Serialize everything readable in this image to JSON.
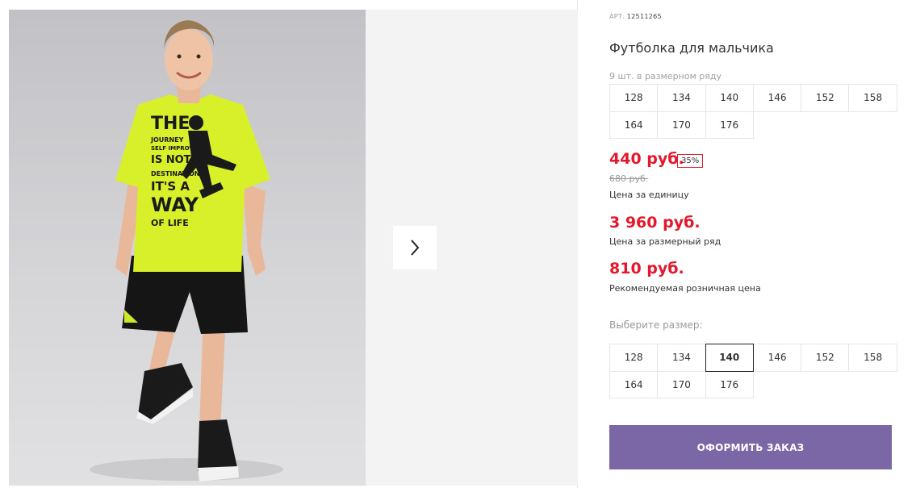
{
  "gallery": {
    "next_icon": "chevron-right-icon",
    "shirt_print": [
      "THE",
      "JOURNEY",
      "SELF IMPROVE",
      "IS NOT",
      "DESTINATION",
      "IT'S A",
      "WAY",
      "OF LIFE"
    ]
  },
  "product": {
    "art_label": "АРТ.",
    "art_value": "12511265",
    "title": "Футболка для мальчика",
    "in_row_text": "9 шт. в размерном ряду",
    "row_sizes": [
      "128",
      "134",
      "140",
      "146",
      "152",
      "158",
      "164",
      "170",
      "176"
    ],
    "price": "440 руб.",
    "discount": "35%",
    "old_price": "680 руб.",
    "price_unit_caption": "Цена за единицу",
    "price_row": "3 960 руб.",
    "price_row_caption": "Цена за размерный ряд",
    "price_rrc": "810 руб.",
    "price_rrc_caption": "Рекомендуемая розничная цена",
    "choose_size_label": "Выберите размер:",
    "sizes": [
      "128",
      "134",
      "140",
      "146",
      "152",
      "158",
      "164",
      "170",
      "176"
    ],
    "selected_size": "140",
    "order_button": "ОФОРМИТЬ ЗАКАЗ"
  },
  "colors": {
    "price_red": "#e3182d",
    "button_purple": "#7b66a6",
    "shirt_lime": "#d7f02a"
  }
}
